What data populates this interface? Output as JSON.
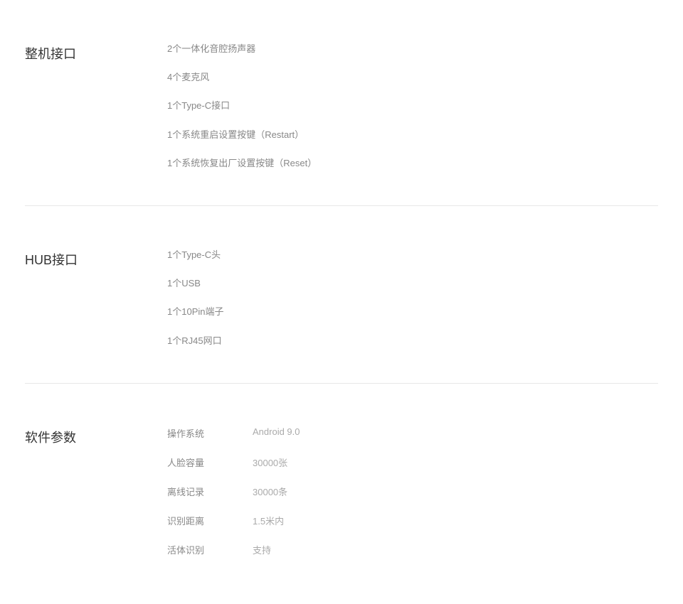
{
  "sections": {
    "machine_interface": {
      "title": "整机接口",
      "items": [
        "2个一体化音腔扬声器",
        "4个麦克风",
        "1个Type-C接口",
        "1个系统重启设置按键（Restart）",
        "1个系统恢复出厂设置按键（Reset）"
      ]
    },
    "hub_interface": {
      "title": "HUB接口",
      "items": [
        "1个Type-C头",
        "1个USB",
        "1个10Pin端子",
        "1个RJ45网口"
      ]
    },
    "software_params": {
      "title": "软件参数",
      "rows": [
        {
          "label": "操作系统",
          "value": "Android 9.0"
        },
        {
          "label": "人脸容量",
          "value": "30000张"
        },
        {
          "label": "离线记录",
          "value": "30000条"
        },
        {
          "label": "识别距离",
          "value": "1.5米内"
        },
        {
          "label": "活体识别",
          "value": "支持"
        }
      ]
    }
  }
}
